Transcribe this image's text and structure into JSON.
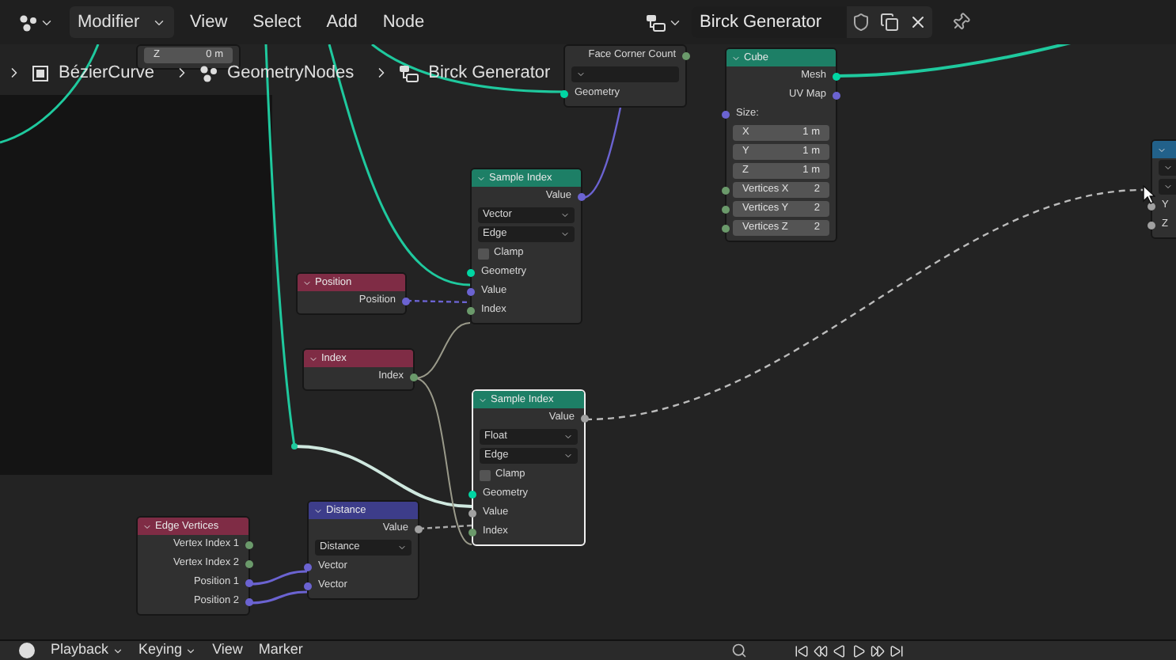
{
  "header": {
    "editor_menu": "Modifier",
    "menus": [
      "View",
      "Select",
      "Add",
      "Node"
    ],
    "node_tree": "Birck Generator"
  },
  "breadcrumbs": [
    "BézierCurve",
    "GeometryNodes",
    "Birck Generator"
  ],
  "nodes": [
    {
      "selected": false,
      "rows": [
        {
          "kind": "field",
          "label": "Z",
          "value": "0 m"
        }
      ]
    },
    {
      "selected": false,
      "rows": [
        {
          "kind": "output",
          "label": "Face Corner Count",
          "color": "#6b9a6b"
        },
        {
          "kind": "dropdown"
        },
        {
          "kind": "input",
          "label": "Geometry",
          "color": "#00d6a3"
        }
      ]
    },
    {
      "title": "Cube",
      "color": "#1d7f66",
      "selected": false,
      "rows": [
        {
          "kind": "output",
          "label": "Mesh",
          "color": "#00d6a3"
        },
        {
          "kind": "output",
          "label": "UV Map",
          "color": "#6b63d1"
        },
        {
          "kind": "input",
          "label": "Size:",
          "color": "#6b63d1"
        },
        {
          "kind": "field",
          "label": "X",
          "value": "1 m"
        },
        {
          "kind": "field",
          "label": "Y",
          "value": "1 m"
        },
        {
          "kind": "field",
          "label": "Z",
          "value": "1 m"
        },
        {
          "kind": "field",
          "label": "Vertices X",
          "value": "2",
          "color": "#6b9a6b"
        },
        {
          "kind": "field",
          "label": "Vertices Y",
          "value": "2",
          "color": "#6b9a6b"
        },
        {
          "kind": "field",
          "label": "Vertices Z",
          "value": "2",
          "color": "#6b9a6b"
        }
      ]
    },
    {
      "title": "Sample Index",
      "color": "#1d7f66",
      "selected": false,
      "rows": [
        {
          "kind": "output",
          "label": "Value",
          "color": "#6b63d1"
        },
        {
          "kind": "dropdown",
          "label": "Vector"
        },
        {
          "kind": "dropdown",
          "label": "Edge"
        },
        {
          "kind": "checkbox",
          "label": "Clamp",
          "checked": false
        },
        {
          "kind": "input",
          "label": "Geometry",
          "color": "#00d6a3"
        },
        {
          "kind": "input",
          "label": "Value",
          "color": "#6b63d1"
        },
        {
          "kind": "input",
          "label": "Index",
          "color": "#6b9a6b"
        }
      ]
    },
    {
      "title": "Position",
      "color": "#7f2c45",
      "selected": false,
      "rows": [
        {
          "kind": "output",
          "label": "Position",
          "color": "#6b63d1"
        }
      ]
    },
    {
      "title": "Index",
      "color": "#7f2c45",
      "selected": false,
      "rows": [
        {
          "kind": "output",
          "label": "Index",
          "color": "#6b9a6b"
        }
      ]
    },
    {
      "title": "Sample Index",
      "color": "#1d7f66",
      "selected": true,
      "rows": [
        {
          "kind": "output",
          "label": "Value",
          "color": "#a1a1a1"
        },
        {
          "kind": "dropdown",
          "label": "Float"
        },
        {
          "kind": "dropdown",
          "label": "Edge"
        },
        {
          "kind": "checkbox",
          "label": "Clamp",
          "checked": false
        },
        {
          "kind": "input",
          "label": "Geometry",
          "color": "#00d6a3"
        },
        {
          "kind": "input",
          "label": "Value",
          "color": "#a1a1a1"
        },
        {
          "kind": "input",
          "label": "Index",
          "color": "#6b9a6b"
        }
      ]
    },
    {
      "title": "Distance",
      "color": "#3d3d8a",
      "selected": false,
      "rows": [
        {
          "kind": "output",
          "label": "Value",
          "color": "#a1a1a1"
        },
        {
          "kind": "dropdown",
          "label": "Distance"
        },
        {
          "kind": "input",
          "label": "Vector",
          "color": "#6b63d1"
        },
        {
          "kind": "input",
          "label": "Vector",
          "color": "#6b63d1"
        }
      ]
    },
    {
      "title": "Edge Vertices",
      "color": "#7f2c45",
      "selected": false,
      "rows": [
        {
          "kind": "output",
          "label": "Vertex Index 1",
          "color": "#6b9a6b"
        },
        {
          "kind": "output",
          "label": "Vertex Index 2",
          "color": "#6b9a6b"
        },
        {
          "kind": "output",
          "label": "Position 1",
          "color": "#6b63d1"
        },
        {
          "kind": "output",
          "label": "Position 2",
          "color": "#6b63d1"
        }
      ]
    },
    {
      "color": "#22618a",
      "selected": false,
      "rows": [
        {
          "kind": "dropdown"
        },
        {
          "kind": "dropdown"
        },
        {
          "kind": "input",
          "label": "Y",
          "color": "#a1a1a1"
        },
        {
          "kind": "input",
          "label": "Z",
          "color": "#a1a1a1"
        }
      ]
    }
  ],
  "timeline": {
    "menus": [
      {
        "label": "Playback",
        "dropdown": true
      },
      {
        "label": "Keying",
        "dropdown": true
      },
      {
        "label": "View",
        "dropdown": false
      },
      {
        "label": "Marker",
        "dropdown": false
      }
    ]
  }
}
